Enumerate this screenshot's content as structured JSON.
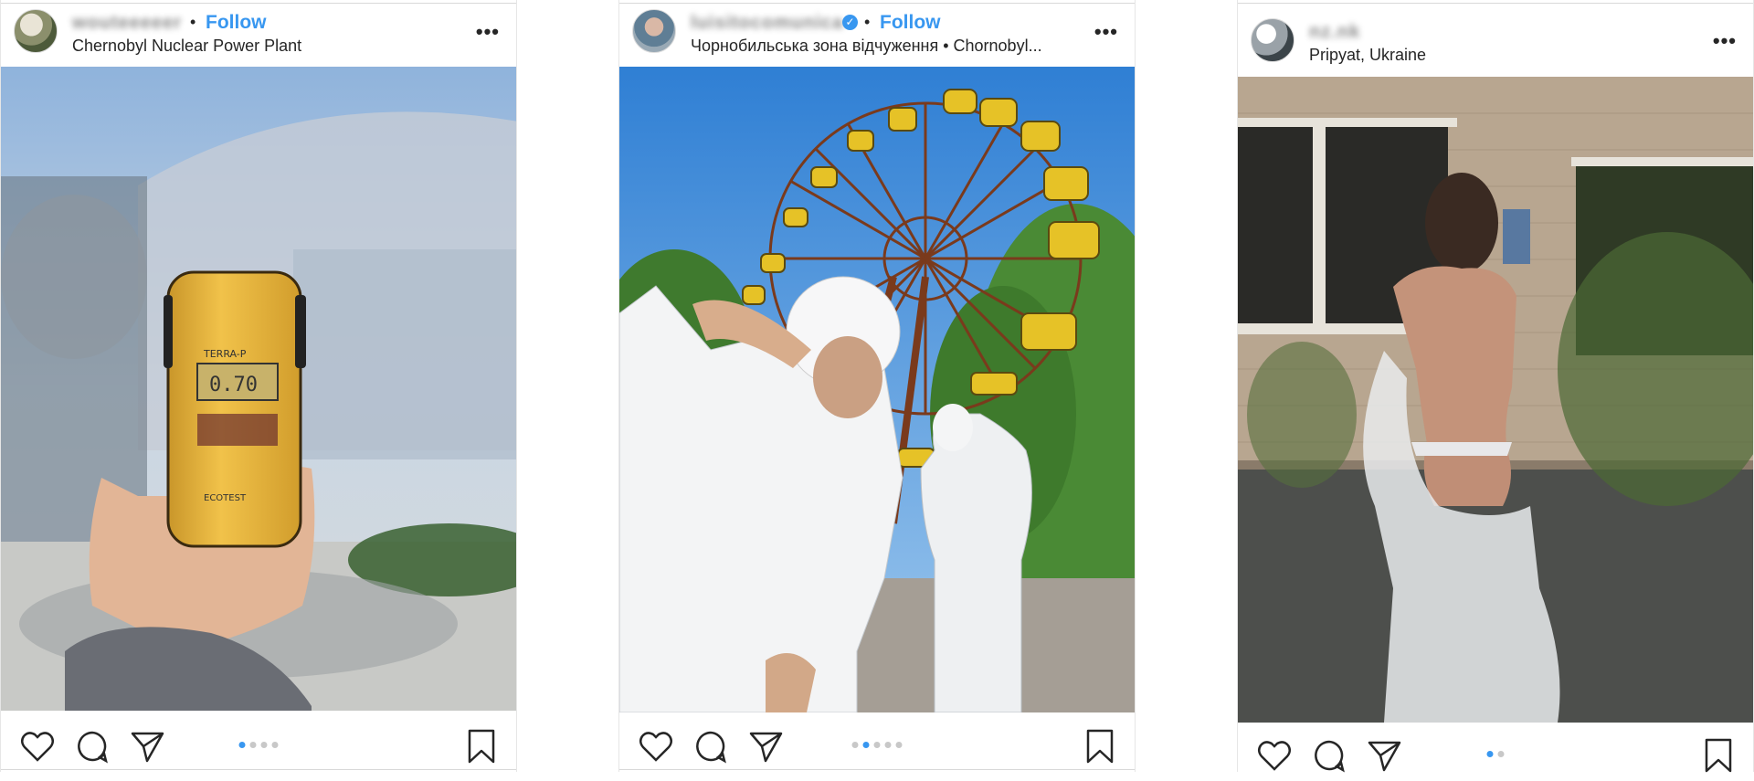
{
  "posts": [
    {
      "username": "wouteeeeer",
      "verified": false,
      "follow_label": "Follow",
      "location": "Chernobyl Nuclear Power Plant",
      "more_icon": "•••",
      "carousel": {
        "count": 4,
        "active": 0
      },
      "icons": [
        "heart-icon",
        "comment-icon",
        "share-icon",
        "bookmark-icon"
      ]
    },
    {
      "username": "luisitocomunica",
      "verified": true,
      "follow_label": "Follow",
      "location": "Чорнобильська зона відчуження • Chornobyl...",
      "more_icon": "•••",
      "carousel": {
        "count": 5,
        "active": 1
      },
      "icons": [
        "heart-icon",
        "comment-icon",
        "share-icon",
        "bookmark-icon"
      ]
    },
    {
      "username": "nz.nk",
      "verified": false,
      "follow_label": "",
      "location": "Pripyat, Ukraine",
      "more_icon": "•••",
      "carousel": {
        "count": 2,
        "active": 0
      },
      "icons": [
        "heart-icon",
        "comment-icon",
        "share-icon",
        "bookmark-icon"
      ]
    }
  ],
  "separator": "•",
  "colors": {
    "accent": "#3897f0",
    "text": "#262626",
    "divider": "#d8d8d8"
  }
}
